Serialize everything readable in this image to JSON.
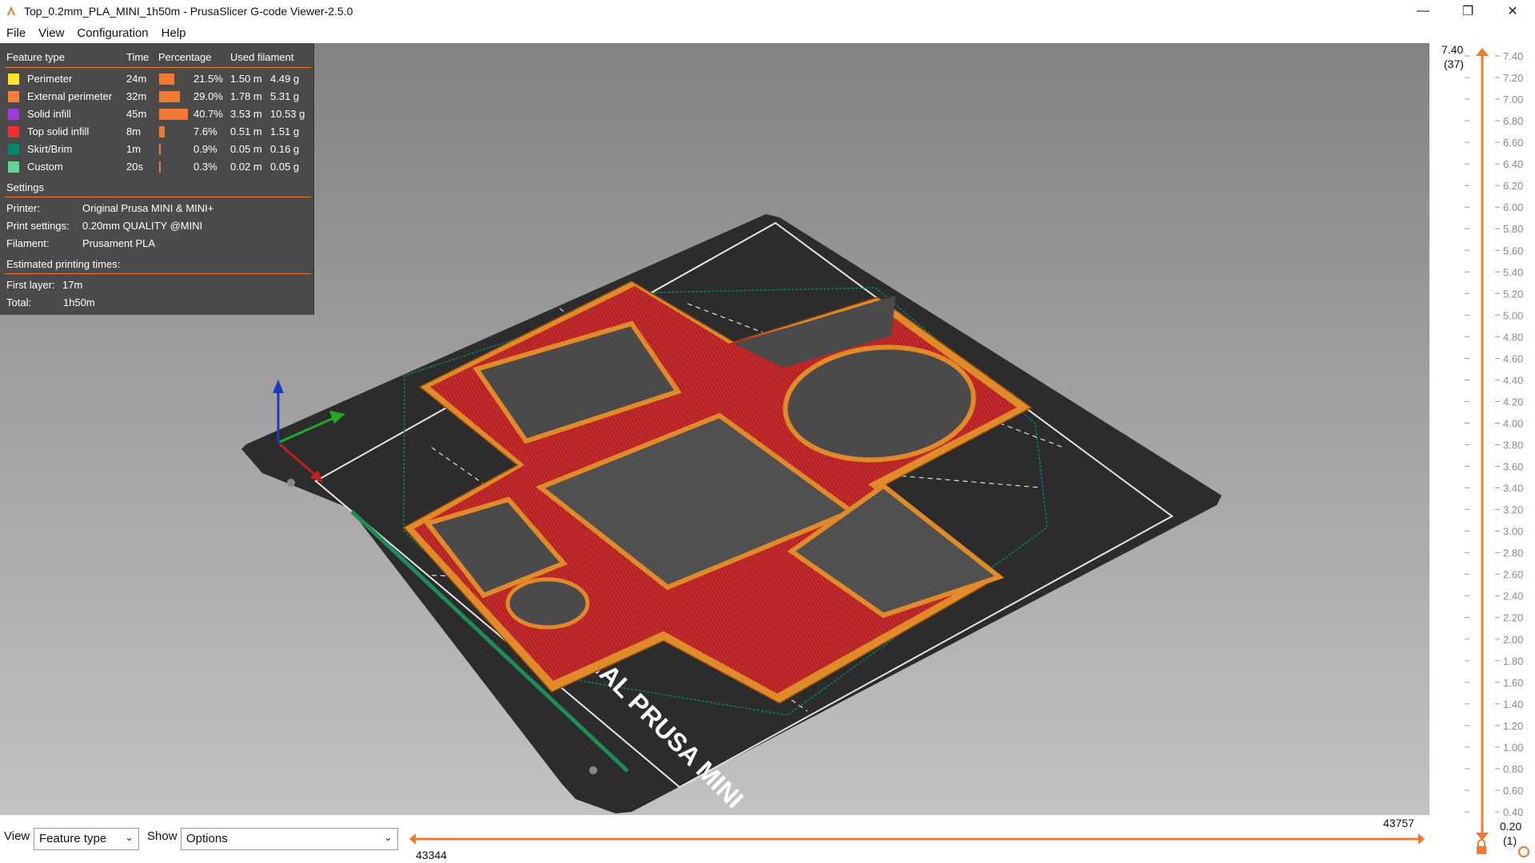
{
  "window": {
    "title": "Top_0.2mm_PLA_MINI_1h50m - PrusaSlicer G-code Viewer-2.5.0",
    "minimize": "—",
    "maximize": "❐",
    "close": "✕"
  },
  "menu": [
    "File",
    "View",
    "Configuration",
    "Help"
  ],
  "legend": {
    "headers": {
      "feature": "Feature type",
      "time": "Time",
      "percentage": "Percentage",
      "filament": "Used filament"
    },
    "features": [
      {
        "name": "Perimeter",
        "time": "24m",
        "pct": "21.5%",
        "pct_value": 21.5,
        "len": "1.50 m",
        "weight": "4.49 g",
        "color": "#ffe626"
      },
      {
        "name": "External perimeter",
        "time": "32m",
        "pct": "29.0%",
        "pct_value": 29.0,
        "len": "1.78 m",
        "weight": "5.31 g",
        "color": "#ff7d38"
      },
      {
        "name": "Solid infill",
        "time": "45m",
        "pct": "40.7%",
        "pct_value": 40.7,
        "len": "3.53 m",
        "weight": "10.53 g",
        "color": "#a13bd7"
      },
      {
        "name": "Top solid infill",
        "time": "8m",
        "pct": "7.6%",
        "pct_value": 7.6,
        "len": "0.51 m",
        "weight": "1.51 g",
        "color": "#f03030"
      },
      {
        "name": "Skirt/Brim",
        "time": "1m",
        "pct": "0.9%",
        "pct_value": 0.9,
        "len": "0.05 m",
        "weight": "0.16 g",
        "color": "#00876e"
      },
      {
        "name": "Custom",
        "time": "20s",
        "pct": "0.3%",
        "pct_value": 0.3,
        "len": "0.02 m",
        "weight": "0.05 g",
        "color": "#5ed694"
      }
    ],
    "settings_title": "Settings",
    "settings": [
      {
        "key": "Printer:",
        "value": "Original Prusa MINI & MINI+"
      },
      {
        "key": "Print settings:",
        "value": "0.20mm QUALITY @MINI"
      },
      {
        "key": "Filament:",
        "value": "Prusament PLA"
      }
    ],
    "times_title": "Estimated printing times:",
    "times": [
      {
        "key": "First layer:",
        "value": "17m"
      },
      {
        "key": "Total:",
        "value": "1h50m"
      }
    ]
  },
  "bed_label": "ORIGINAL PRUSA MINI",
  "vertical_slider": {
    "top_value": "7.40",
    "top_layer": "(37)",
    "bottom_value": "0.20",
    "bottom_layer": "(1)",
    "ticks": [
      "7.40",
      "7.20",
      "7.00",
      "6.80",
      "6.60",
      "6.40",
      "6.20",
      "6.00",
      "5.80",
      "5.60",
      "5.40",
      "5.20",
      "5.00",
      "4.80",
      "4.60",
      "4.40",
      "4.20",
      "4.00",
      "3.80",
      "3.60",
      "3.40",
      "3.20",
      "3.00",
      "2.80",
      "2.60",
      "2.40",
      "2.20",
      "2.00",
      "1.80",
      "1.60",
      "1.40",
      "1.20",
      "1.00",
      "0.80",
      "0.60",
      "0.40"
    ]
  },
  "horizontal_slider": {
    "right_value": "43757",
    "left_value": "43344"
  },
  "bottom": {
    "view_label": "View",
    "view_value": "Feature type",
    "show_label": "Show",
    "show_value": "Options"
  },
  "colors": {
    "accent": "#f07a32",
    "legend_bg": "#484848",
    "bed": "#2b2b2b",
    "top_infill": "#c0282a",
    "perimeter": "#e08a2a"
  }
}
